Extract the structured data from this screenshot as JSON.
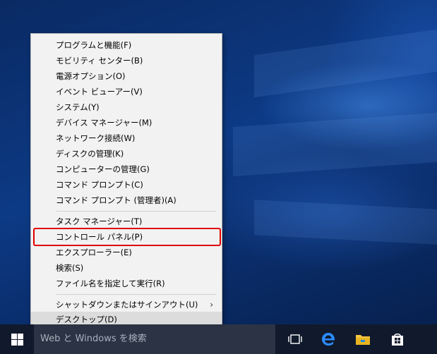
{
  "menu": {
    "items": [
      {
        "label": "プログラムと機能(F)"
      },
      {
        "label": "モビリティ センター(B)"
      },
      {
        "label": "電源オプション(O)"
      },
      {
        "label": "イベント ビューアー(V)"
      },
      {
        "label": "システム(Y)"
      },
      {
        "label": "デバイス マネージャー(M)"
      },
      {
        "label": "ネットワーク接続(W)"
      },
      {
        "label": "ディスクの管理(K)"
      },
      {
        "label": "コンピューターの管理(G)"
      },
      {
        "label": "コマンド プロンプト(C)"
      },
      {
        "label": "コマンド プロンプト (管理者)(A)"
      },
      {
        "label": "タスク マネージャー(T)"
      },
      {
        "label": "コントロール パネル(P)"
      },
      {
        "label": "エクスプローラー(E)"
      },
      {
        "label": "検索(S)"
      },
      {
        "label": "ファイル名を指定して実行(R)"
      },
      {
        "label": "シャットダウンまたはサインアウト(U)"
      },
      {
        "label": "デスクトップ(D)"
      }
    ],
    "submenu_arrow": "›",
    "highlight_color": "#e00000"
  },
  "taskbar": {
    "search_placeholder": "Web と Windows を検索",
    "icons": [
      "windows-logo-icon",
      "task-view-icon",
      "edge-icon",
      "file-explorer-icon",
      "store-icon"
    ]
  }
}
